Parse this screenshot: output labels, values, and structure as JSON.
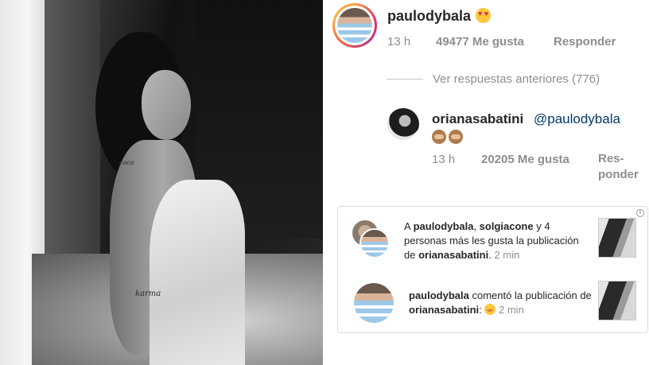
{
  "comment_main": {
    "username": "paulodybala",
    "emoji": "heart-eyes-emoji",
    "time": "13 h",
    "likes": "49477 Me gusta",
    "reply": "Responder"
  },
  "view_more": "Ver respuestas anteriores (776)",
  "reply_comment": {
    "username": "orianasabatini",
    "mention": "@paulodybala",
    "emoji": "see-no-evil-monkey-emoji",
    "time": "13 h",
    "likes": "20205 Me gusta",
    "reply": "Res-\nponder"
  },
  "notifications": [
    {
      "prefix": "A ",
      "user1": "paulodybala",
      "sep": ", ",
      "user2": "solgiacone",
      "middle": " y 4 personas más les gusta la publicación de ",
      "owner": "orianasabatini",
      "end": ".",
      "time": "2 min"
    },
    {
      "user": "paulodybala",
      "middle": " comentó la publicación de ",
      "owner": "orianasabatini",
      "end": ":",
      "time": "2 min"
    }
  ],
  "photo_tattoos": [
    "coco",
    "karma"
  ],
  "info_icon": "i"
}
